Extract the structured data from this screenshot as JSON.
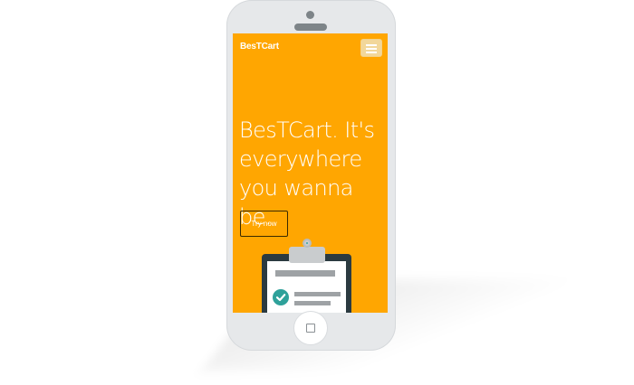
{
  "app": {
    "brand": "BesTCart"
  },
  "hero": {
    "headline": "BesTCart. It's everywhere you wanna be.",
    "cta_label": "Try now"
  },
  "icons": {
    "menu": "hamburger-menu-icon",
    "illustration": "clipboard-checklist-icon",
    "check": "checkmark-icon",
    "home": "home-button-icon"
  },
  "colors": {
    "screen_background": "#ffa601",
    "phone_body": "#e6e8ea",
    "text": "#ffffff",
    "check_accent": "#2ea19a"
  }
}
